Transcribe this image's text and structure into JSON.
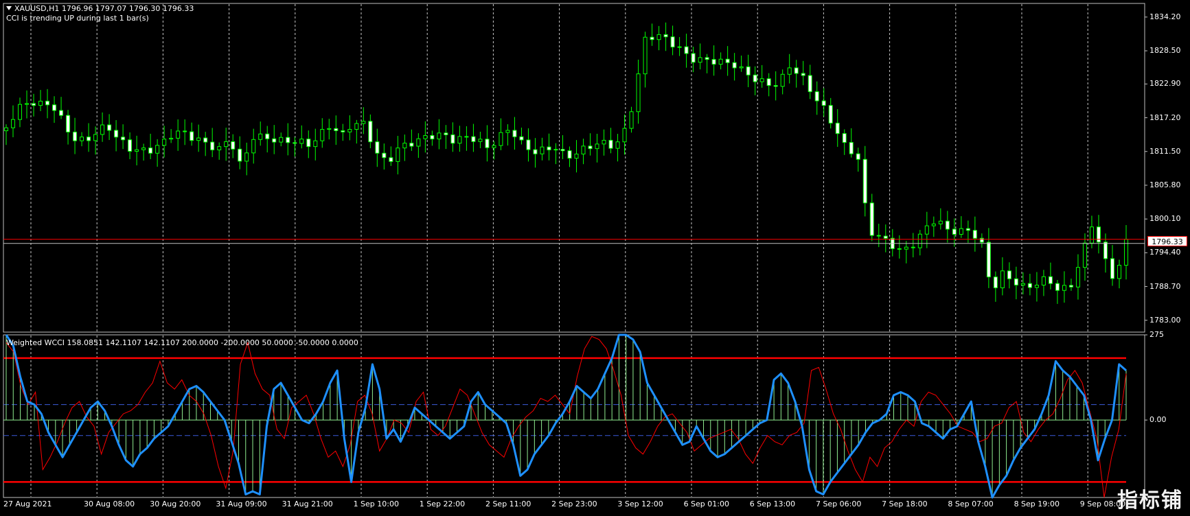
{
  "main_window": {
    "symbol_info": "XAUUSD,H1  1796.96 1797.07 1796.30 1796.33",
    "indicator_status": "CCI is trending UP during last 1 bar(s)",
    "current_price": "1796.33",
    "price_ticks": [
      "1834.20",
      "1828.50",
      "1822.90",
      "1817.20",
      "1811.50",
      "1805.80",
      "1800.10",
      "1794.40",
      "1788.70",
      "1783.00"
    ]
  },
  "indicator_window": {
    "info": "Weighted WCCI 158.0851 142.1107 142.1107 200.0000 -200.0000 50.0000 -50.0000 0.0000",
    "ticks": [
      "275",
      "0.00"
    ]
  },
  "time_axis": {
    "labels": [
      "27 Aug 2021",
      "30 Aug 08:00",
      "30 Aug 20:00",
      "31 Aug 09:00",
      "31 Aug 21:00",
      "1 Sep 10:00",
      "1 Sep 22:00",
      "2 Sep 11:00",
      "2 Sep 23:00",
      "3 Sep 12:00",
      "6 Sep 01:00",
      "6 Sep 13:00",
      "7 Sep 06:00",
      "7 Sep 18:00",
      "8 Sep 07:00",
      "8 Sep 19:00",
      "9 Sep 08:00"
    ]
  },
  "watermark": "指标铺",
  "colors": {
    "background": "#000000",
    "candle": "#00ff00",
    "grid": "#c8c8c8",
    "bid_line": "#ff0000",
    "ask_line": "#c0c0c0",
    "cci_fast": "#ff0000",
    "cci_slow": "#1e90ff",
    "histogram": "#90ee90",
    "levels": "#ff0000",
    "level_dash": "#3b5bdb"
  },
  "chart_data": [
    {
      "type": "candlestick",
      "title": "",
      "x_labels": [
        "27 Aug 2021",
        "30 Aug 08:00",
        "30 Aug 20:00",
        "31 Aug 09:00",
        "31 Aug 21:00",
        "1 Sep 10:00",
        "1 Sep 22:00",
        "2 Sep 11:00",
        "2 Sep 23:00",
        "3 Sep 12:00",
        "6 Sep 01:00",
        "6 Sep 13:00",
        "7 Sep 06:00",
        "7 Sep 18:00",
        "8 Sep 07:00",
        "8 Sep 19:00",
        "9 Sep 08:00"
      ],
      "ylim": [
        1781.0,
        1836.5
      ],
      "close_anchors": [
        1815.5,
        1818.0,
        1819.0,
        1818.6,
        1819.3,
        1817.0,
        1814.4,
        1814.2,
        1815.2,
        1816.1,
        1813.0,
        1811.2,
        1810.7,
        1811.4,
        1813.2,
        1815.6,
        1815.4,
        1814.3,
        1812.8,
        1811.4,
        1812.8,
        1807.8,
        1813.6,
        1814.0,
        1814.2,
        1814.1,
        1814.0,
        1812.8,
        1813.8,
        1815.2,
        1813.2,
        1815.9,
        1816.1,
        1812.1,
        1810.4,
        1812.8,
        1813.1,
        1813.2,
        1813.4,
        1813.4,
        1812.8,
        1813.9,
        1814.3,
        1812.9,
        1814.7,
        1815.8,
        1812.6,
        1810.6,
        1810.8,
        1811.7,
        1810.4,
        1811.9,
        1813.2,
        1813.9,
        1812.9,
        1813.3,
        1819.1,
        1829.4,
        1830.6,
        1830.3,
        1829.6,
        1828.2,
        1827.8,
        1827.3,
        1826.4,
        1825.5,
        1823.8,
        1822.9,
        1822.6,
        1823.4,
        1826.9,
        1825.1,
        1821.8,
        1818.6,
        1814.8,
        1811.0,
        1810.4,
        1798.0,
        1797.4,
        1796.7,
        1795.4,
        1796.4,
        1798.2,
        1799.6,
        1797.3,
        1797.2,
        1797.8,
        1797.0,
        1788.8,
        1791.8,
        1790.2,
        1788.4,
        1788.7,
        1789.1,
        1787.2,
        1788.2,
        1793.8,
        1800.4,
        1794.4,
        1790.4,
        1796.3
      ],
      "bid": 1796.33
    },
    {
      "type": "line",
      "title": "",
      "series": [
        {
          "name": "",
          "values": [
            250,
            220,
            110,
            50,
            90,
            -160,
            -120,
            -70,
            -10,
            40,
            60,
            10,
            -20,
            -110,
            -40,
            -10,
            20,
            30,
            50,
            90,
            120,
            190,
            120,
            100,
            130,
            80,
            60,
            20,
            -50,
            -150,
            -220,
            -100,
            180,
            250,
            150,
            100,
            80,
            -30,
            -60,
            40,
            60,
            80,
            20,
            -60,
            -120,
            -100,
            -150,
            -80,
            60,
            80,
            20,
            -100,
            -60,
            0,
            -10,
            -40,
            60,
            90,
            -30,
            -50,
            -20,
            40,
            100,
            80,
            20,
            -40,
            -80,
            -100,
            -120,
            -60,
            -20,
            10,
            30,
            70,
            60,
            80,
            50,
            20,
            140,
            230,
            270,
            260,
            230,
            160,
            80,
            -50,
            -90,
            -110,
            -70,
            -20,
            10,
            20,
            -10,
            -40,
            -100,
            -80,
            -60,
            -50,
            -40,
            -30,
            -60,
            -110,
            -140,
            -90,
            -50,
            -70,
            -80,
            -50,
            -40,
            -10,
            160,
            170,
            100,
            20,
            -30,
            -100,
            -160,
            -200,
            -120,
            -150,
            -90,
            -70,
            -30,
            0,
            -20,
            60,
            90,
            80,
            50,
            20,
            -20,
            -30,
            -40,
            -70,
            -60,
            -20,
            -10,
            40,
            60,
            -40,
            -70,
            -30,
            0,
            20,
            70,
            130,
            160,
            120,
            30,
            -60,
            -250,
            -120,
            -30,
            150
          ],
          "role": "fast"
        },
        {
          "name": "",
          "values": [
            275,
            240,
            140,
            60,
            50,
            20,
            -40,
            -80,
            -120,
            -80,
            -40,
            0,
            40,
            60,
            30,
            -20,
            -80,
            -130,
            -150,
            -110,
            -90,
            -60,
            -40,
            -20,
            20,
            60,
            100,
            110,
            90,
            60,
            30,
            0,
            -70,
            -140,
            -240,
            -230,
            -240,
            -20,
            100,
            120,
            80,
            40,
            0,
            -10,
            20,
            60,
            120,
            160,
            -60,
            -200,
            -40,
            40,
            180,
            100,
            -60,
            -30,
            -70,
            -20,
            40,
            20,
            0,
            -20,
            -40,
            -60,
            -40,
            -20,
            60,
            90,
            50,
            30,
            10,
            -10,
            -80,
            -180,
            -160,
            -110,
            -80,
            -50,
            -10,
            20,
            60,
            110,
            90,
            70,
            100,
            150,
            200,
            275,
            275,
            260,
            220,
            120,
            80,
            40,
            0,
            -40,
            -80,
            -70,
            -20,
            -60,
            -100,
            -120,
            -110,
            -90,
            -70,
            -50,
            -30,
            -10,
            0,
            130,
            150,
            120,
            60,
            -20,
            -160,
            -230,
            -240,
            -200,
            -170,
            -140,
            -110,
            -80,
            -40,
            -10,
            0,
            20,
            80,
            90,
            80,
            60,
            -10,
            -20,
            -40,
            -60,
            -30,
            -20,
            20,
            60,
            -70,
            -150,
            -250,
            -210,
            -180,
            -130,
            -90,
            -60,
            -30,
            20,
            80,
            190,
            160,
            140,
            110,
            80,
            0,
            -130,
            -60,
            0,
            180,
            160
          ],
          "role": "slow"
        }
      ],
      "levels": [
        200,
        50,
        0,
        -50,
        -200
      ],
      "ylim": [
        -250,
        275
      ]
    }
  ]
}
